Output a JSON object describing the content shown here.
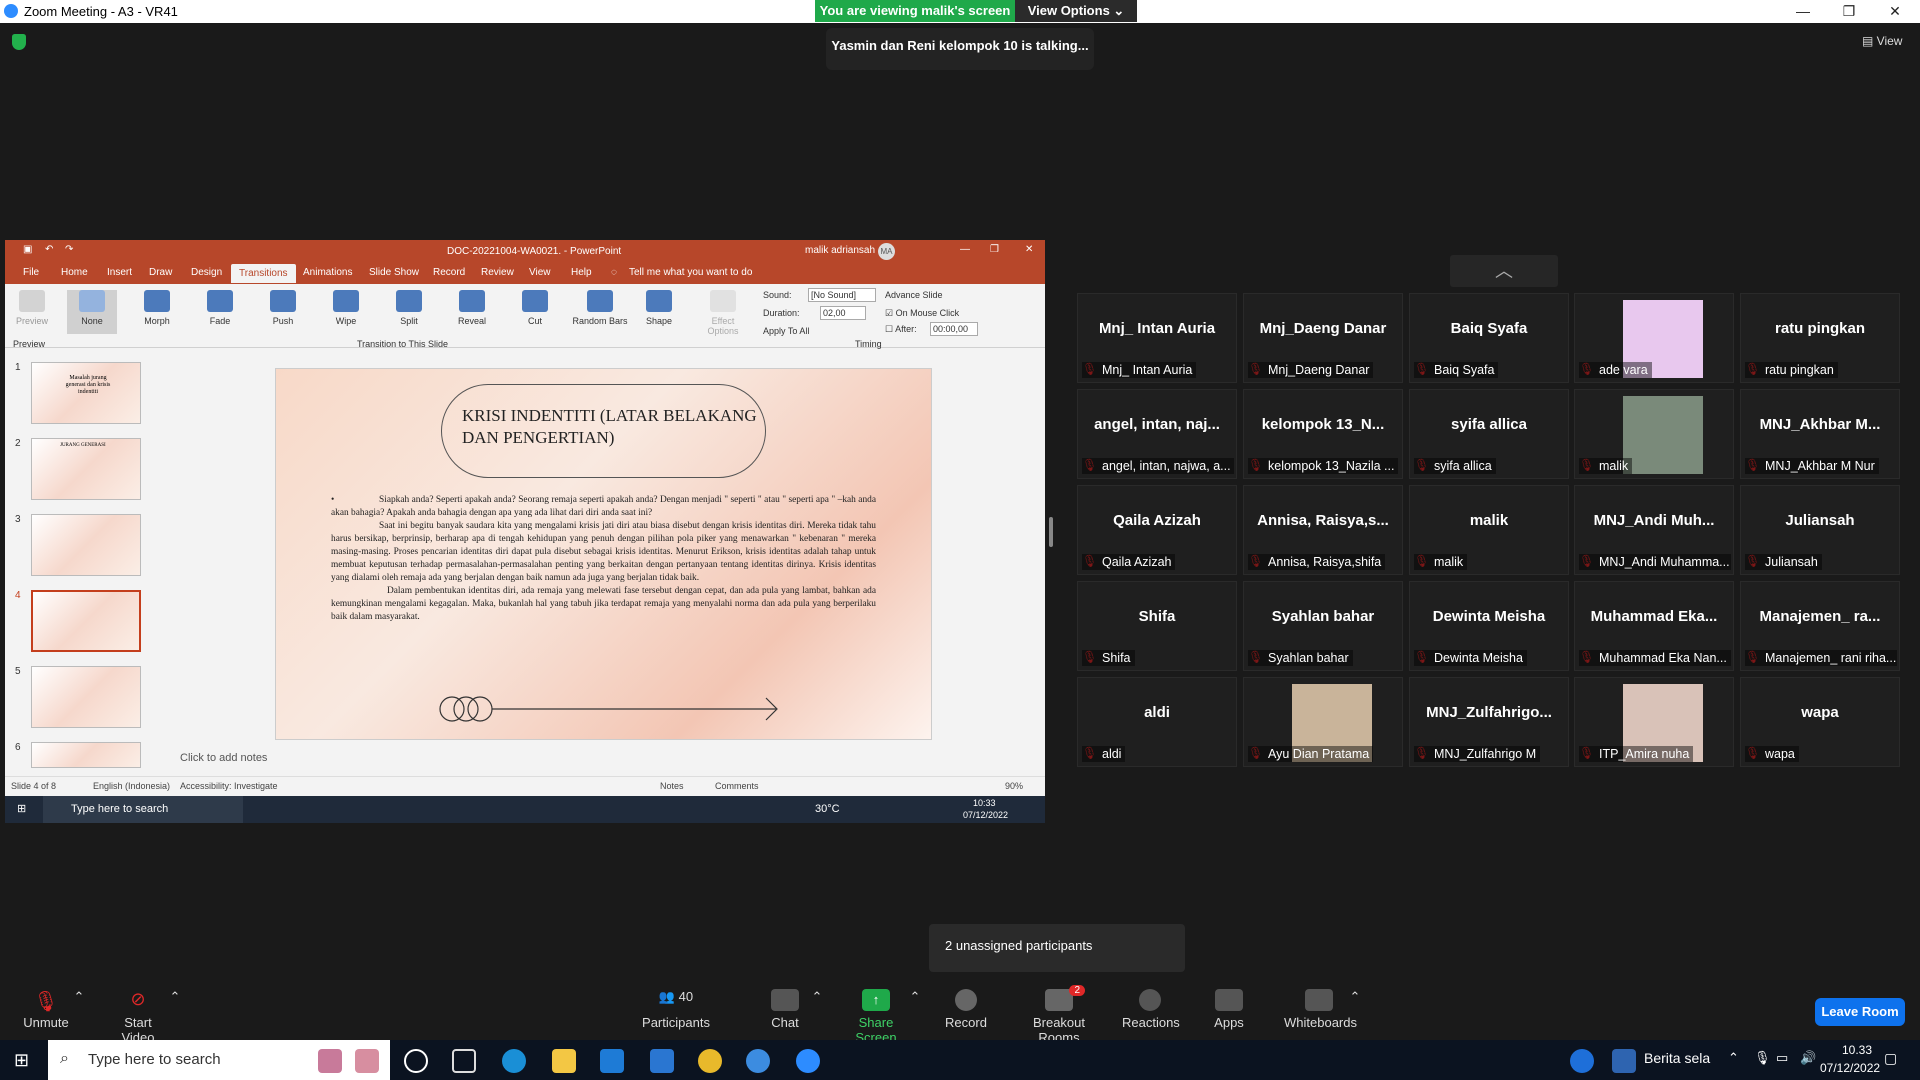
{
  "window": {
    "title": "Zoom Meeting - A3 - VR41",
    "view_button": "View"
  },
  "banner": {
    "viewing": "You are viewing malik's screen",
    "view_options": "View Options"
  },
  "talking": "Yasmin dan Reni kelompok 10 is talking...",
  "powerpoint": {
    "title": "DOC-20221004-WA0021. - PowerPoint",
    "user": "malik adriansah",
    "user_initials": "MA",
    "menu": [
      "File",
      "Home",
      "Insert",
      "Draw",
      "Design",
      "Transitions",
      "Animations",
      "Slide Show",
      "Record",
      "Review",
      "View",
      "Help"
    ],
    "active_tab": "Transitions",
    "tell_me": "Tell me what you want to do",
    "transitions": [
      "None",
      "Morph",
      "Fade",
      "Push",
      "Wipe",
      "Split",
      "Reveal",
      "Cut",
      "Random Bars",
      "Shape"
    ],
    "preview_label": "Preview",
    "effect_options": "Effect Options",
    "group_preview": "Preview",
    "group_transition": "Transition to This Slide",
    "group_timing": "Timing",
    "sound_label": "Sound:",
    "sound_value": "[No Sound]",
    "duration_label": "Duration:",
    "duration_value": "02,00",
    "apply_all": "Apply To All",
    "advance": "Advance Slide",
    "on_click": "On Mouse Click",
    "after_label": "After:",
    "after_value": "00:00,00",
    "thumb_numbers": [
      "1",
      "2",
      "3",
      "4",
      "5",
      "6"
    ],
    "thumb_texts": [
      "Masalah jurang generasi dan krisis indentiti",
      "JURANG GENERASI"
    ],
    "slide_title": "KRISI INDENTITI (LATAR BELAKANG DAN PENGERTIAN)",
    "slide_bullet": "•",
    "slide_p1": "Siapkah anda? Seperti apakah anda? Seorang remaja seperti apakah anda? Dengan menjadi \" seperti \" atau \" seperti apa \" –kah anda akan bahagia? Apakah anda bahagia dengan apa yang ada lihat dari diri anda saat ini?",
    "slide_p2": "Saat ini begitu banyak saudara kita yang mengalami krisis jati diri atau biasa disebut dengan krisis identitas diri. Mereka tidak tahu harus bersikap, berprinsip, berharap apa di tengah kehidupan yang penuh dengan pilihan pola piker yang menawarkan \" kebenaran \" mereka masing-masing. Proses pencarian identitas diri dapat pula disebut sebagai krisis identitas. Menurut Erikson, krisis identitas adalah tahap untuk membuat keputusan terhadap permasalahan-permasalahan penting yang berkaitan dengan pertanyaan tentang identitas dirinya. Krisis identitas yang dialami oleh remaja ada yang berjalan dengan baik namun ada juga yang berjalan tidak baik.",
    "slide_p3": "Dalam pembentukan identitas diri, ada remaja yang melewati fase tersebut dengan cepat, dan ada pula yang lambat, bahkan ada kemungkinan mengalami kegagalan. Maka, bukanlah hal yang tabuh jika terdapat remaja yang menyalahi norma dan ada pula yang berperilaku baik dalam masyarakat.",
    "notes_placeholder": "Click to add notes",
    "status_slide": "Slide 4 of 8",
    "status_lang": "English (Indonesia)",
    "status_access": "Accessibility: Investigate",
    "status_notes": "Notes",
    "status_comments": "Comments",
    "zoom": "90%",
    "taskbar_search": "Type here to search",
    "temp": "30°C",
    "time": "10:33",
    "date": "07/12/2022"
  },
  "participants": [
    {
      "name": "Mnj_ Intan Auria",
      "label": "Mnj_ Intan Auria"
    },
    {
      "name": "Mnj_Daeng Danar",
      "label": "Mnj_Daeng Danar"
    },
    {
      "name": "Baiq Syafa",
      "label": "Baiq Syafa"
    },
    {
      "name": "",
      "label": "ade vara",
      "photo": "#e8c8ee"
    },
    {
      "name": "ratu pingkan",
      "label": "ratu pingkan"
    },
    {
      "name": "angel,  intan,  naj...",
      "label": "angel, intan, najwa, a..."
    },
    {
      "name": "kelompok  13_N...",
      "label": "kelompok 13_Nazila ..."
    },
    {
      "name": "syifa allica",
      "label": "syifa allica"
    },
    {
      "name": "",
      "label": "malik",
      "photo": "#7a8a7a"
    },
    {
      "name": "MNJ_Akhbar  M...",
      "label": "MNJ_Akhbar M Nur"
    },
    {
      "name": "Qaila Azizah",
      "label": "Qaila Azizah"
    },
    {
      "name": "Annisa,  Raisya,s...",
      "label": "Annisa, Raisya,shifa"
    },
    {
      "name": "malik",
      "label": "malik"
    },
    {
      "name": "MNJ_Andi  Muh...",
      "label": "MNJ_Andi Muhamma..."
    },
    {
      "name": "Juliansah",
      "label": "Juliansah"
    },
    {
      "name": "Shifa",
      "label": "Shifa"
    },
    {
      "name": "Syahlan bahar",
      "label": "Syahlan bahar"
    },
    {
      "name": "Dewinta Meisha",
      "label": "Dewinta Meisha"
    },
    {
      "name": "Muhammad  Eka...",
      "label": "Muhammad Eka Nan..."
    },
    {
      "name": "Manajemen_  ra...",
      "label": "Manajemen_ rani riha..."
    },
    {
      "name": "aldi",
      "label": "aldi"
    },
    {
      "name": "",
      "label": "Ayu Dian Pratama",
      "photo": "#c9b49a"
    },
    {
      "name": "MNJ_Zulfahrigo...",
      "label": "MNJ_Zulfahrigo M"
    },
    {
      "name": "",
      "label": "ITP_Amira nuha",
      "photo": "#d9c2b8"
    },
    {
      "name": "wapa",
      "label": "wapa"
    }
  ],
  "unassigned": "2 unassigned participants",
  "toolbar": {
    "unmute": "Unmute",
    "start_video": "Start Video",
    "participants": "Participants",
    "participants_count": "40",
    "chat": "Chat",
    "share_screen": "Share Screen",
    "record": "Record",
    "breakout": "Breakout Rooms",
    "breakout_badge": "2",
    "reactions": "Reactions",
    "apps": "Apps",
    "whiteboards": "Whiteboards",
    "leave": "Leave Room"
  },
  "taskbar": {
    "search": "Type here to search",
    "news": "Berita sela",
    "time": "10.33",
    "date": "07/12/2022"
  },
  "colors": {
    "zoom_blue": "#2d8cff",
    "share_green": "#1fa94a",
    "ppt_red": "#b7472a",
    "leave_blue": "#0e72ed",
    "muted_red": "#e02828"
  }
}
